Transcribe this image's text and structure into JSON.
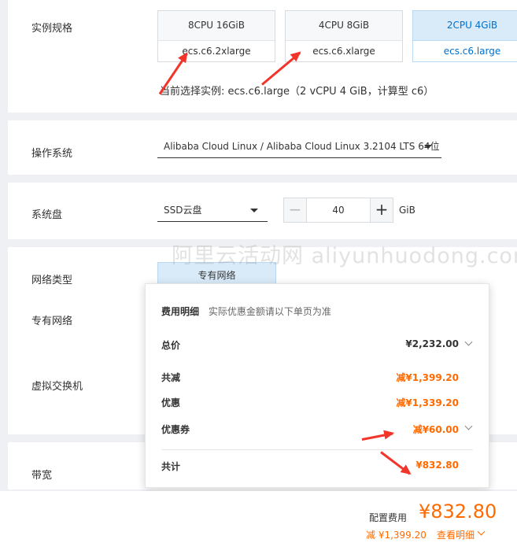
{
  "instance_spec": {
    "label": "实例规格",
    "cards": [
      {
        "top": "8CPU 16GiB",
        "bottom": "ecs.c6.2xlarge"
      },
      {
        "top": "4CPU 8GiB",
        "bottom": "ecs.c6.xlarge"
      },
      {
        "top": "2CPU 4GiB",
        "bottom": "ecs.c6.large"
      }
    ],
    "current_selection": "当前选择实例: ecs.c6.large（2 vCPU 4 GiB，计算型 c6）"
  },
  "os": {
    "label": "操作系统",
    "value": "Alibaba Cloud Linux / Alibaba Cloud Linux 3.2104 LTS 64位"
  },
  "system_disk": {
    "label": "系统盘",
    "type": "SSD云盘",
    "minus": "−",
    "size": "40",
    "plus": "+",
    "unit": "GiB"
  },
  "network": {
    "type_label": "网络类型",
    "type_value": "专有网络",
    "vpc_label": "专有网络",
    "vswitch_label": "虚拟交换机",
    "bandwidth_label": "带宽"
  },
  "watermark": "阿里云活动网 aliyunhuodong.com",
  "cost_popup": {
    "title": "费用明细",
    "subtitle": "实际优惠金额请以下单页为准",
    "total_label": "总价",
    "total_value": "¥2,232.00",
    "discount_label": "共减",
    "discount_value": "减¥1,399.20",
    "promo_label": "优惠",
    "promo_value": "减¥1,339.20",
    "coupon_label": "优惠券",
    "coupon_value": "减¥60.00",
    "sum_label": "共计",
    "sum_value": "¥832.80"
  },
  "footer": {
    "config_fee_label": "配置费用",
    "config_fee_value": "¥832.80",
    "saved": "减 ¥1,399.20",
    "details_link": "查看明细"
  },
  "colors": {
    "accent_orange": "#ff6a00",
    "selected_blue": "#0070cc",
    "arrow_red": "#f2352a"
  }
}
